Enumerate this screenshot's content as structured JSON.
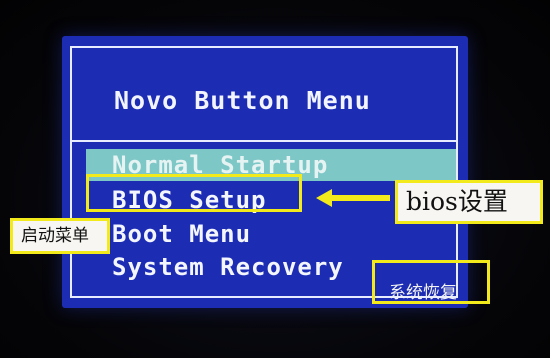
{
  "menu": {
    "title": "Novo Button Menu",
    "items": [
      {
        "label": "Normal Startup",
        "selected": true
      },
      {
        "label": "BIOS Setup",
        "selected": false
      },
      {
        "label": "Boot Menu",
        "selected": false
      },
      {
        "label": "System Recovery",
        "selected": false
      }
    ]
  },
  "annotations": {
    "bios": "bios设置",
    "boot": "启动菜单",
    "recovery": "系统恢复"
  },
  "colors": {
    "menu_background": "#1c2db4",
    "selected_bar": "#7ec7c7",
    "highlight_border": "#f3ea1c",
    "text": "#f4f6ff"
  },
  "icons": {
    "annotation_arrow": "left-arrow-icon"
  }
}
